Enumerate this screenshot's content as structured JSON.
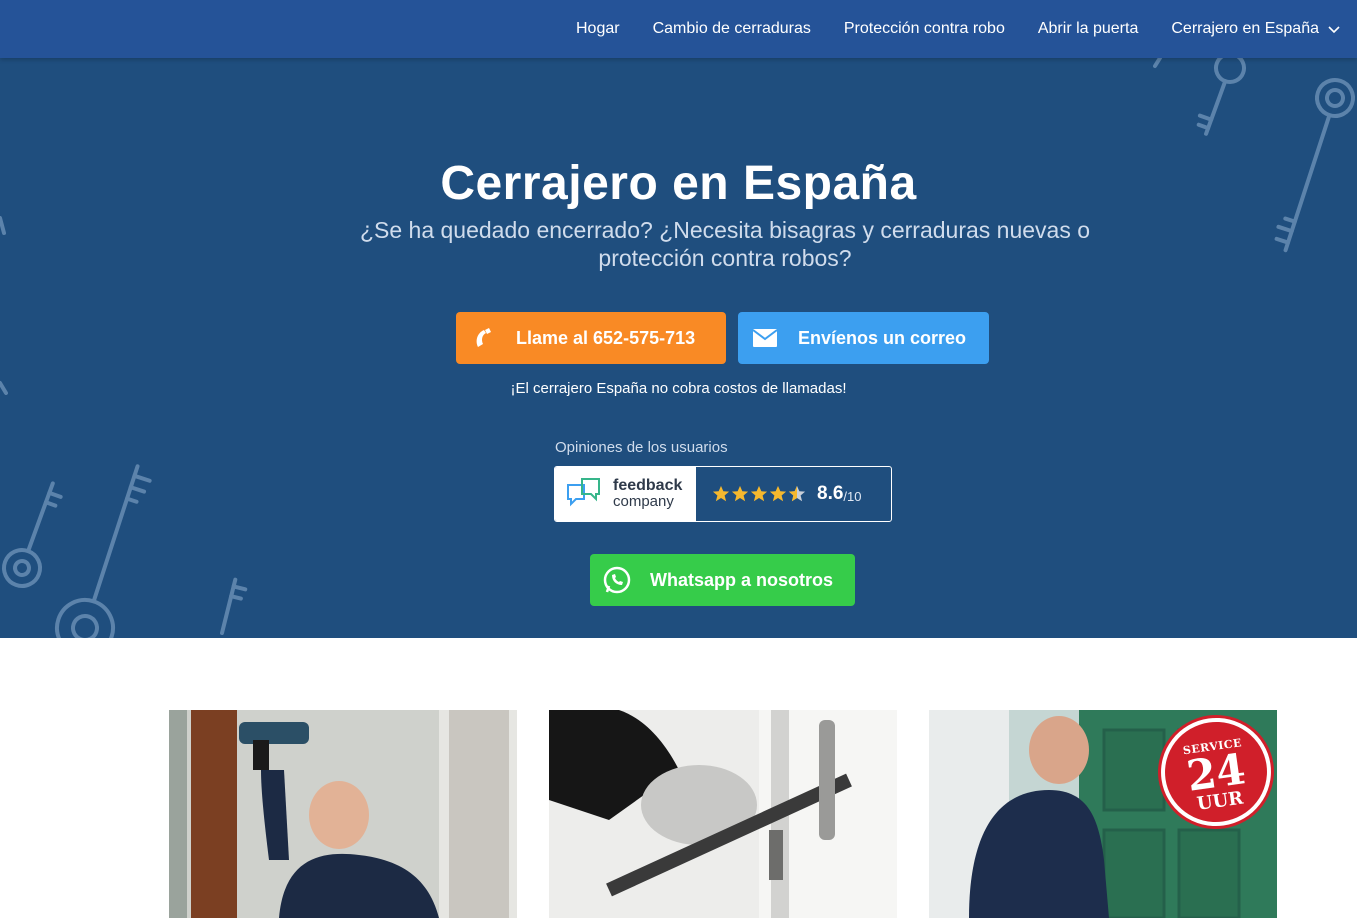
{
  "nav": {
    "items": [
      {
        "label": "Hogar"
      },
      {
        "label": "Cambio de cerraduras"
      },
      {
        "label": "Protección contra robo"
      },
      {
        "label": "Abrir la puerta"
      },
      {
        "label": "Cerrajero en España",
        "icon": "chevron-down-icon"
      }
    ]
  },
  "hero": {
    "title": "Cerrajero en España",
    "subtitle": "¿Se ha quedado encerrado? ¿Necesita bisagras y cerraduras nuevas o protección contra robos?",
    "call_button": {
      "label": "Llame al 652-575-713",
      "icon": "phone-icon",
      "color": "#f98a25"
    },
    "mail_button": {
      "label": "Envíenos un correo",
      "icon": "envelope-icon",
      "color": "#3c9ff0"
    },
    "no_cost_note": "¡El cerrajero España no cobra costos de llamadas!",
    "reviews": {
      "label": "Opiniones de los usuarios",
      "provider_line1": "feedback",
      "provider_line2": "company",
      "stars": 4.5,
      "score": "8.6",
      "score_max": "/10"
    },
    "whatsapp_button": {
      "label": "Whatsapp a nosotros",
      "icon": "whatsapp-icon",
      "color": "#36cc4a"
    },
    "background_color": "#1f4e7e"
  },
  "tiles": [
    {
      "photo": "locksmith-drilling-photo"
    },
    {
      "photo": "crowbar-break-in-photo"
    },
    {
      "photo": "locksmith-green-door-photo",
      "badge_line1": "SERVICE",
      "badge_line2": "24",
      "badge_line3": "UUR"
    }
  ],
  "colors": {
    "nav": "#255398",
    "accent_orange": "#f98a25",
    "accent_blue": "#3c9ff0",
    "accent_green": "#36cc4a"
  }
}
